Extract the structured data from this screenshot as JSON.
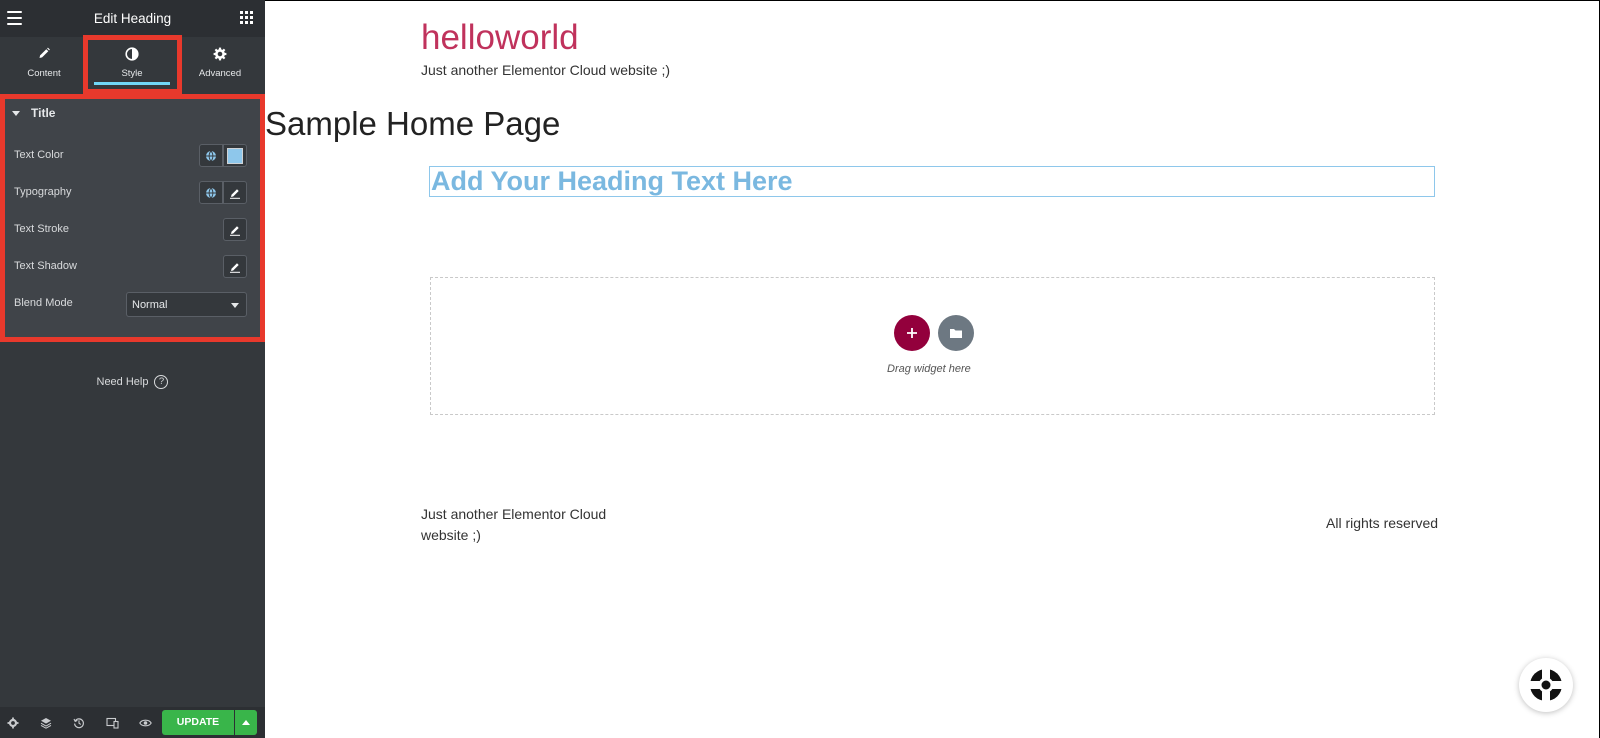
{
  "panel": {
    "header_title": "Edit Heading",
    "tabs": [
      {
        "label": "Content",
        "icon": "pencil-icon"
      },
      {
        "label": "Style",
        "icon": "contrast-icon",
        "active": true
      },
      {
        "label": "Advanced",
        "icon": "gear-icon"
      }
    ],
    "section_title": "Title",
    "controls": {
      "text_color": "Text Color",
      "typography": "Typography",
      "text_stroke": "Text Stroke",
      "text_shadow": "Text Shadow",
      "blend_mode": "Blend Mode",
      "blend_mode_value": "Normal",
      "color_value": "#8ec7eb"
    },
    "help": "Need Help",
    "help_glyph": "?",
    "update_label": "UPDATE"
  },
  "canvas": {
    "site_title": "helloworld",
    "tagline": "Just another Elementor Cloud website ;)",
    "page_title": "Sample Home Page",
    "heading": "Add Your Heading Text Here",
    "drag_text": "Drag widget here",
    "footer_tagline": "Just another Elementor Cloud website ;)",
    "rights": "All rights reserved"
  },
  "colors": {
    "accent_red": "#e8392c",
    "brand_pink": "#c0325c",
    "add_button": "#93003c",
    "update_green": "#39b54a"
  }
}
